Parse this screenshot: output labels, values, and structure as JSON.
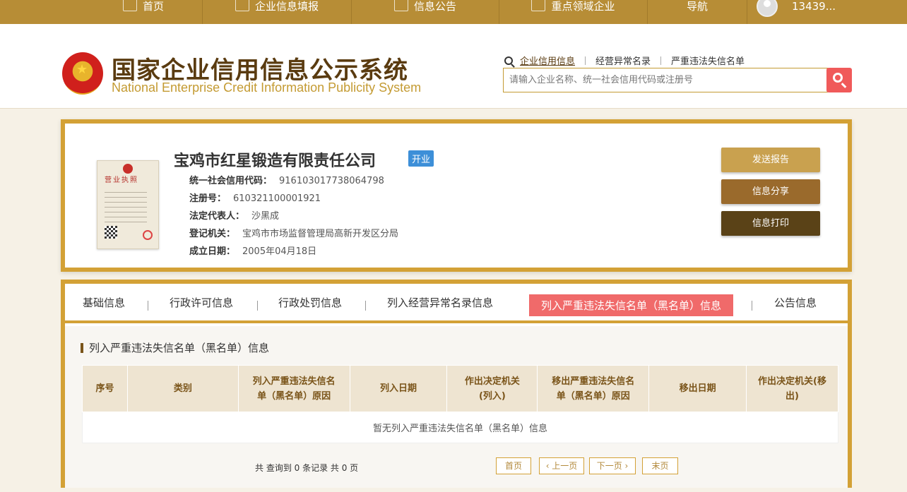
{
  "topnav": {
    "home": "首页",
    "report": "企业信息填报",
    "notice": "信息公告",
    "key": "重点领域企业",
    "guide": "导航",
    "user": "13439..."
  },
  "header": {
    "title_cn": "国家企业信用信息公示系统",
    "title_en": "National Enterprise Credit Information Publicity System",
    "search_tabs": [
      "企业信用信息",
      "经营异常名录",
      "严重违法失信名单"
    ],
    "search_placeholder": "请输入企业名称、统一社会信用代码或注册号"
  },
  "company": {
    "license_title": "营业执照",
    "name": "宝鸡市红星锻造有限责任公司",
    "status": "开业",
    "fields": [
      {
        "key": "统一社会信用代码：",
        "value": "916103017738064798"
      },
      {
        "key": "注册号：",
        "value": "610321100001921"
      },
      {
        "key": "法定代表人：",
        "value": "沙黑成"
      },
      {
        "key": "登记机关：",
        "value": "宝鸡市市场监督管理局高新开发区分局"
      },
      {
        "key": "成立日期：",
        "value": "2005年04月18日"
      }
    ],
    "buttons": {
      "send": "发送报告",
      "share": "信息分享",
      "print": "信息打印"
    }
  },
  "tabs": [
    "基础信息",
    "行政许可信息",
    "行政处罚信息",
    "列入经营异常名录信息",
    "列入严重违法失信名单（黑名单）信息",
    "公告信息"
  ],
  "section": {
    "title": "列入严重违法失信名单（黑名单）信息",
    "columns": [
      "序号",
      "类别",
      "列入严重违法失信名单（黑名单）原因",
      "列入日期",
      "作出决定机关(列入)",
      "移出严重违法失信名单（黑名单）原因",
      "移出日期",
      "作出决定机关(移出)"
    ],
    "empty": "暂无列入严重违法失信名单（黑名单）信息"
  },
  "pager": {
    "summary": "共 查询到 0 条记录 共 0 页",
    "first": "首页",
    "prev": "‹ 上一页",
    "next": "下一页 ›",
    "last": "末页"
  }
}
